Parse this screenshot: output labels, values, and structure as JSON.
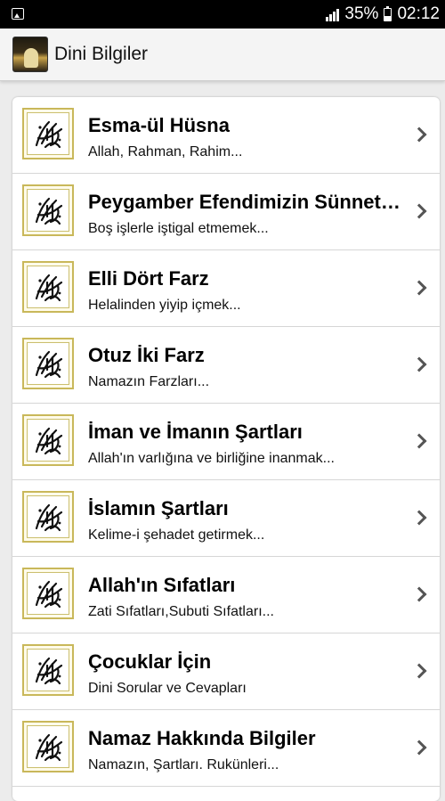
{
  "status_bar": {
    "battery": "35%",
    "time": "02:12",
    "icons": [
      "image-notification-icon",
      "signal-icon",
      "battery-icon"
    ]
  },
  "app_bar": {
    "title": "Dini Bilgiler",
    "icon": "app-logo-icon"
  },
  "items": [
    {
      "title": "Esma-ül Hüsna",
      "subtitle": "Allah, Rahman, Rahim..."
    },
    {
      "title": "Peygamber Efendimizin Sünnetleri",
      "subtitle": "Boş işlerle iştigal etmemek..."
    },
    {
      "title": "Elli Dört Farz",
      "subtitle": "Helalinden yiyip içmek..."
    },
    {
      "title": "Otuz İki Farz",
      "subtitle": "Namazın Farzları..."
    },
    {
      "title": "İman ve İmanın Şartları",
      "subtitle": "Allah'ın varlığına ve birliğine inanmak..."
    },
    {
      "title": "İslamın Şartları",
      "subtitle": "Kelime-i şehadet getirmek..."
    },
    {
      "title": "Allah'ın Sıfatları",
      "subtitle": "Zati Sıfatları,Subuti Sıfatları..."
    },
    {
      "title": "Çocuklar İçin",
      "subtitle": "Dini Sorular ve Cevapları"
    },
    {
      "title": "Namaz Hakkında Bilgiler",
      "subtitle": "Namazın, Şartları. Rukünleri..."
    }
  ],
  "colors": {
    "status_bar_bg": "#000000",
    "app_bar_bg": "#f4f4f4",
    "page_bg": "#ececec",
    "thumb_border": "#c9b85a"
  }
}
